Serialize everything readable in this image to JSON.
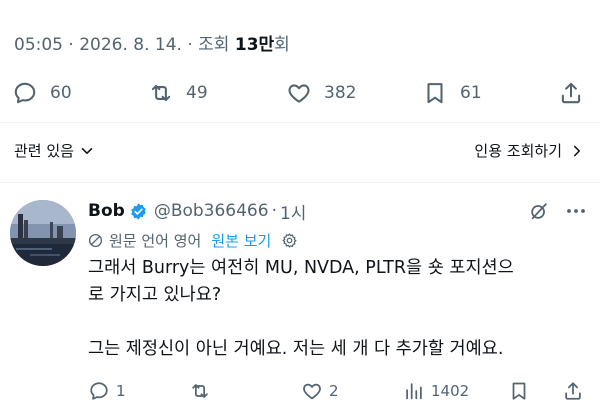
{
  "tweet_meta": {
    "time": "05:05",
    "dot1": "·",
    "date": "2026. 8. 14.",
    "dot2": "·",
    "views_prefix": "조회",
    "views_count": "13만",
    "views_suffix": "회"
  },
  "tweet_actions": {
    "replies": "60",
    "reposts": "49",
    "likes": "382",
    "bookmarks": "61"
  },
  "related_label": "관련 있음",
  "quote_views_label": "인용 조회하기",
  "reply": {
    "name": "Bob",
    "handle": "@Bob366466",
    "sep": "·",
    "time": "1시",
    "translation": {
      "label": "원문 언어 영어",
      "show_original": "원본 보기"
    },
    "text": "그래서 Burry는 여전히 MU, NVDA, PLTR을 숏 포지션으\n로 가지고 있나요?\n\n그는 제정신이 아닌 거예요. 저는 세 개 다 추가할 거예요.",
    "actions": {
      "replies": "1",
      "reposts": "",
      "likes": "2",
      "views": "1402"
    }
  },
  "colors": {
    "text": "#0f1419",
    "secondary": "#536471",
    "accent": "#1d9bf0",
    "divider": "#eff3f4"
  },
  "icons": {
    "reply": "speech-bubble-icon",
    "repost": "repost-icon",
    "like": "heart-icon",
    "bookmark": "bookmark-icon",
    "share": "share-icon",
    "views": "bar-chart-icon",
    "verified": "verified-badge-icon",
    "grok": "grok-icon",
    "more": "more-icon",
    "globe": "globe-icon",
    "settings": "gear-icon"
  }
}
